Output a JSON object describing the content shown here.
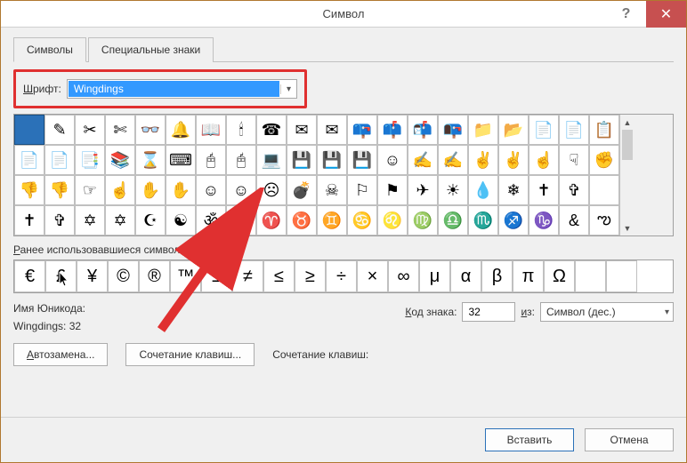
{
  "window": {
    "title": "Символ"
  },
  "tabs": [
    "Символы",
    "Специальные знаки"
  ],
  "font": {
    "label_pre": "Ш",
    "label_post": "рифт:",
    "value": "Wingdings"
  },
  "symbol_grid": [
    [
      "",
      "✎",
      "✂",
      "✄",
      "👓",
      "🔔",
      "📖",
      "🕯",
      "☎",
      "✉",
      "✉",
      "📪",
      "📫",
      "📬",
      "📭",
      "📁",
      "📂",
      "📄",
      "📄",
      "📋"
    ],
    [
      "📄",
      "📄",
      "📑",
      "📚",
      "⌛",
      "⌨",
      "🖰",
      "🖰",
      "💻",
      "💾",
      "💾",
      "💾",
      "☺",
      "✍",
      "✍",
      "✌",
      "✌",
      "☝",
      "☟",
      "✊"
    ],
    [
      "👎",
      "👎",
      "☞",
      "☝",
      "✋",
      "✋",
      "☺",
      "☺",
      "☹",
      "💣",
      "☠",
      "⚐",
      "⚑",
      "✈",
      "☀",
      "💧",
      "❄",
      "✝",
      "✞",
      " "
    ],
    [
      "✝",
      "✞",
      "✡",
      "✡",
      "☪",
      "☯",
      "ॐ",
      "⚙",
      "♈",
      "♉",
      "♊",
      "♋",
      "♌",
      "♍",
      "♎",
      "♏",
      "♐",
      "♑",
      "&",
      "ఌ"
    ]
  ],
  "recent_label_pre": "Р",
  "recent_label_post": "анее использовавшиеся символы:",
  "recent_symbols": [
    "€",
    "£",
    "¥",
    "©",
    "®",
    "™",
    "±",
    "≠",
    "≤",
    "≥",
    "÷",
    "×",
    "∞",
    "μ",
    "α",
    "β",
    "π",
    "Ω"
  ],
  "unicode": {
    "name_label": "Имя Юникода:",
    "name_value": "Wingdings: 32",
    "code_label_pre": "К",
    "code_label_post": "од знака:",
    "code_value": "32",
    "from_label_pre": "и",
    "from_label_post": "з:",
    "from_value": "Символ (дес.)"
  },
  "buttons": {
    "autocorrect_pre": "А",
    "autocorrect_post": "втозамена...",
    "shortcut": "Сочетание клавиш...",
    "shortcut_label": "Сочетание клавиш:",
    "insert": "Вставить",
    "cancel": "Отмена"
  }
}
